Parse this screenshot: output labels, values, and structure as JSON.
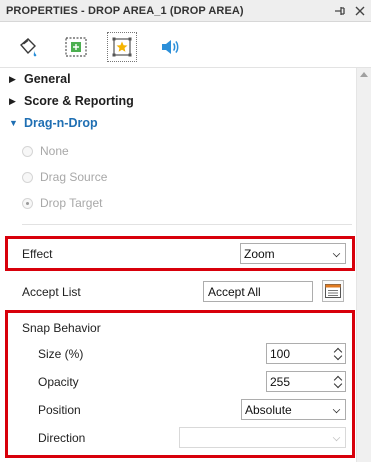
{
  "panel": {
    "title": "PROPERTIES - DROP AREA_1 (DROP AREA)",
    "pin_glyph": "⊣",
    "close_glyph": "✕"
  },
  "tabs": [
    {
      "name": "fill-bucket-icon",
      "active": false
    },
    {
      "name": "size-position-icon",
      "active": false
    },
    {
      "name": "interaction-star-icon",
      "active": true
    },
    {
      "name": "audio-speaker-icon",
      "active": false
    }
  ],
  "sections": {
    "general": "General",
    "score_reporting": "Score & Reporting",
    "drag_n_drop": "Drag-n-Drop"
  },
  "drag_options": {
    "none": "None",
    "drag_source": "Drag Source",
    "drop_target": "Drop Target",
    "selected": "Drop Target"
  },
  "effect": {
    "label": "Effect",
    "value": "Zoom"
  },
  "accept_list": {
    "label": "Accept List",
    "value": "Accept All"
  },
  "snap": {
    "label": "Snap Behavior",
    "size_label": "Size (%)",
    "size_value": "100",
    "opacity_label": "Opacity",
    "opacity_value": "255",
    "position_label": "Position",
    "position_value": "Absolute",
    "direction_label": "Direction",
    "direction_value": ""
  },
  "colors": {
    "highlight": "#d8000b",
    "section_expanded": "#1f6fb3"
  }
}
